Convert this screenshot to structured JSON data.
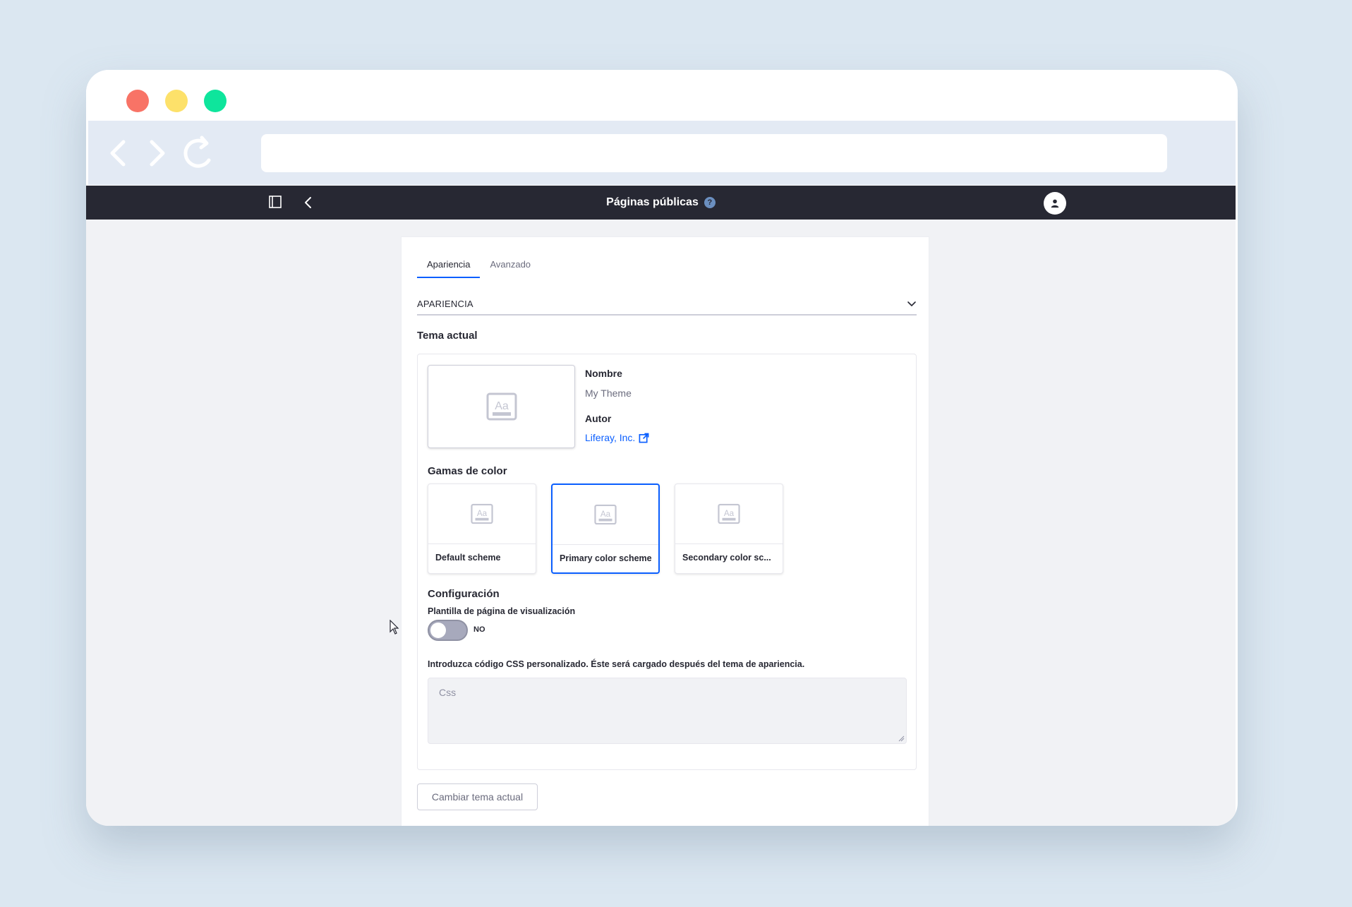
{
  "colors": {
    "background": "#dbe7f1",
    "appbar": "#272833",
    "accent": "#0b5fff",
    "dot_red": "#f87366",
    "dot_yellow": "#fde16a",
    "dot_green": "#0ee59c"
  },
  "browser": {
    "address_value": "",
    "icons": [
      "back-icon",
      "forward-icon",
      "reload-icon"
    ]
  },
  "header": {
    "title": "Páginas públicas",
    "help_icon": "?",
    "icons": [
      "sidebar-toggle-icon",
      "back-arrow-icon",
      "help-icon",
      "user-avatar-icon"
    ]
  },
  "tabs": [
    {
      "label": "Apariencia",
      "active": true
    },
    {
      "label": "Avanzado",
      "active": false
    }
  ],
  "section": {
    "title": "APARIENCIA",
    "expanded": true
  },
  "current_theme": {
    "heading": "Tema actual",
    "name_label": "Nombre",
    "name_value": "My Theme",
    "author_label": "Autor",
    "author_value": "Liferay, Inc."
  },
  "color_schemes": {
    "heading": "Gamas de color",
    "items": [
      {
        "name": "Default scheme",
        "selected": false
      },
      {
        "name": "Primary color scheme",
        "selected": true
      },
      {
        "name": "Secondary color sc...",
        "selected": false
      }
    ]
  },
  "configuration": {
    "heading": "Configuración",
    "toggle_label": "Plantilla de página de visualización",
    "toggle_state": "NO",
    "css_label": "Introduzca código CSS personalizado. Éste será cargado después del tema de apariencia.",
    "css_placeholder": "Css",
    "css_value": ""
  },
  "actions": {
    "change_theme_label": "Cambiar tema actual"
  }
}
